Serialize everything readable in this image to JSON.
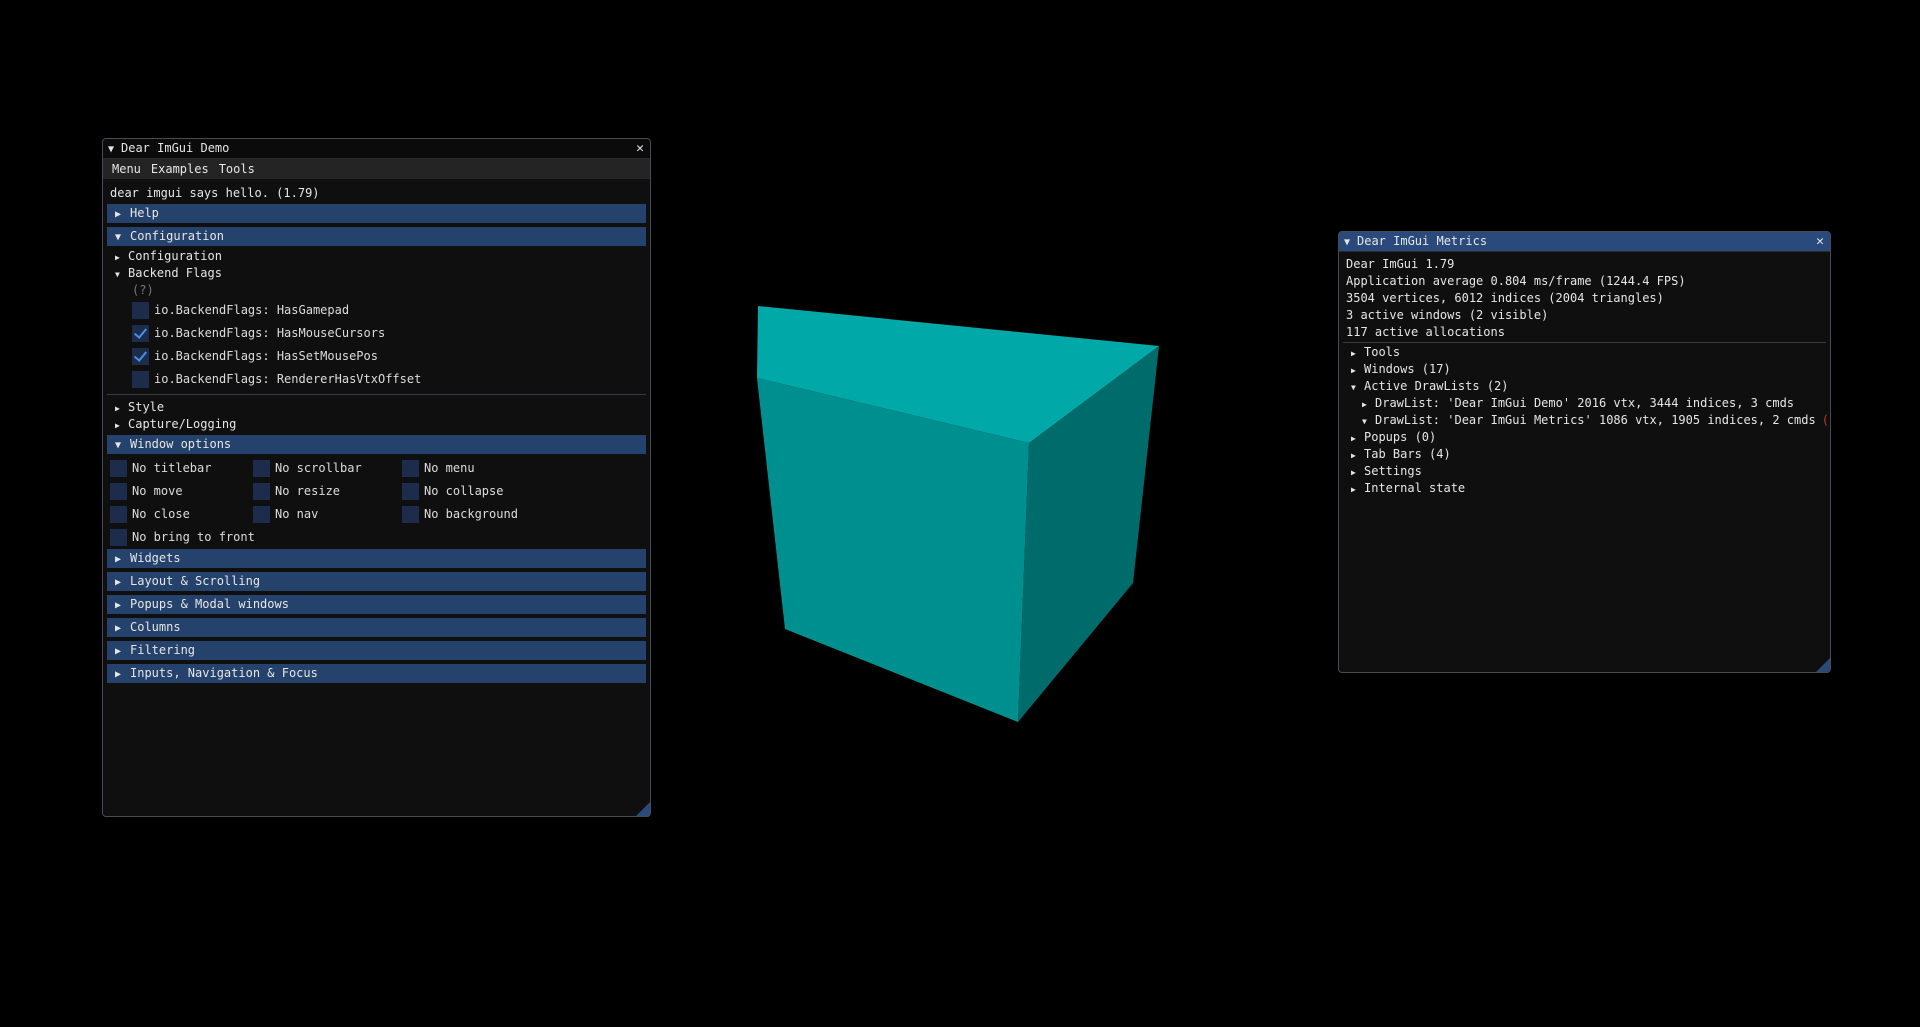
{
  "demo": {
    "title": "Dear ImGui Demo",
    "menu": [
      "Menu",
      "Examples",
      "Tools"
    ],
    "hello": "dear imgui says hello. (1.79)",
    "help_header": "Help",
    "config_header": "Configuration",
    "config_node": "Configuration",
    "backend_node": "Backend Flags",
    "help_marker": "(?)",
    "backend_flags": [
      {
        "label": "io.BackendFlags: HasGamepad",
        "checked": false
      },
      {
        "label": "io.BackendFlags: HasMouseCursors",
        "checked": true
      },
      {
        "label": "io.BackendFlags: HasSetMousePos",
        "checked": true
      },
      {
        "label": "io.BackendFlags: RendererHasVtxOffset",
        "checked": false
      }
    ],
    "style_node": "Style",
    "capture_node": "Capture/Logging",
    "window_options_header": "Window options",
    "window_options": [
      {
        "label": "No titlebar",
        "checked": false
      },
      {
        "label": "No scrollbar",
        "checked": false
      },
      {
        "label": "No menu",
        "checked": false
      },
      {
        "label": "No move",
        "checked": false
      },
      {
        "label": "No resize",
        "checked": false
      },
      {
        "label": "No collapse",
        "checked": false
      },
      {
        "label": "No close",
        "checked": false
      },
      {
        "label": "No nav",
        "checked": false
      },
      {
        "label": "No background",
        "checked": false
      },
      {
        "label": "No bring to front",
        "checked": false
      }
    ],
    "headers": [
      "Widgets",
      "Layout & Scrolling",
      "Popups & Modal windows",
      "Columns",
      "Filtering",
      "Inputs, Navigation & Focus"
    ]
  },
  "metrics": {
    "title": "Dear ImGui Metrics",
    "lines": [
      "Dear ImGui 1.79",
      "Application average 0.804 ms/frame (1244.4 FPS)",
      "3504 vertices, 6012 indices (2004 triangles)",
      "3 active windows (2 visible)",
      "117 active allocations"
    ],
    "tools": "Tools",
    "windows": "Windows (17)",
    "drawlists": "Active DrawLists (2)",
    "drawlist_1": "DrawList: 'Dear ImGui Demo' 2016 vtx, 3444 indices, 3 cmds",
    "drawlist_2": "DrawList: 'Dear ImGui Metrics' 1086 vtx, 1905 indices, 2 cmds",
    "popups": "Popups (0)",
    "tab_bars": "Tab Bars (4)",
    "settings": "Settings",
    "internal": "Internal state"
  },
  "colors": {
    "cube_top": "#00a8a8",
    "cube_left": "#008f8f",
    "cube_right": "#006b6b",
    "header_bg": "#24426b",
    "title_active": "#294a7a"
  }
}
